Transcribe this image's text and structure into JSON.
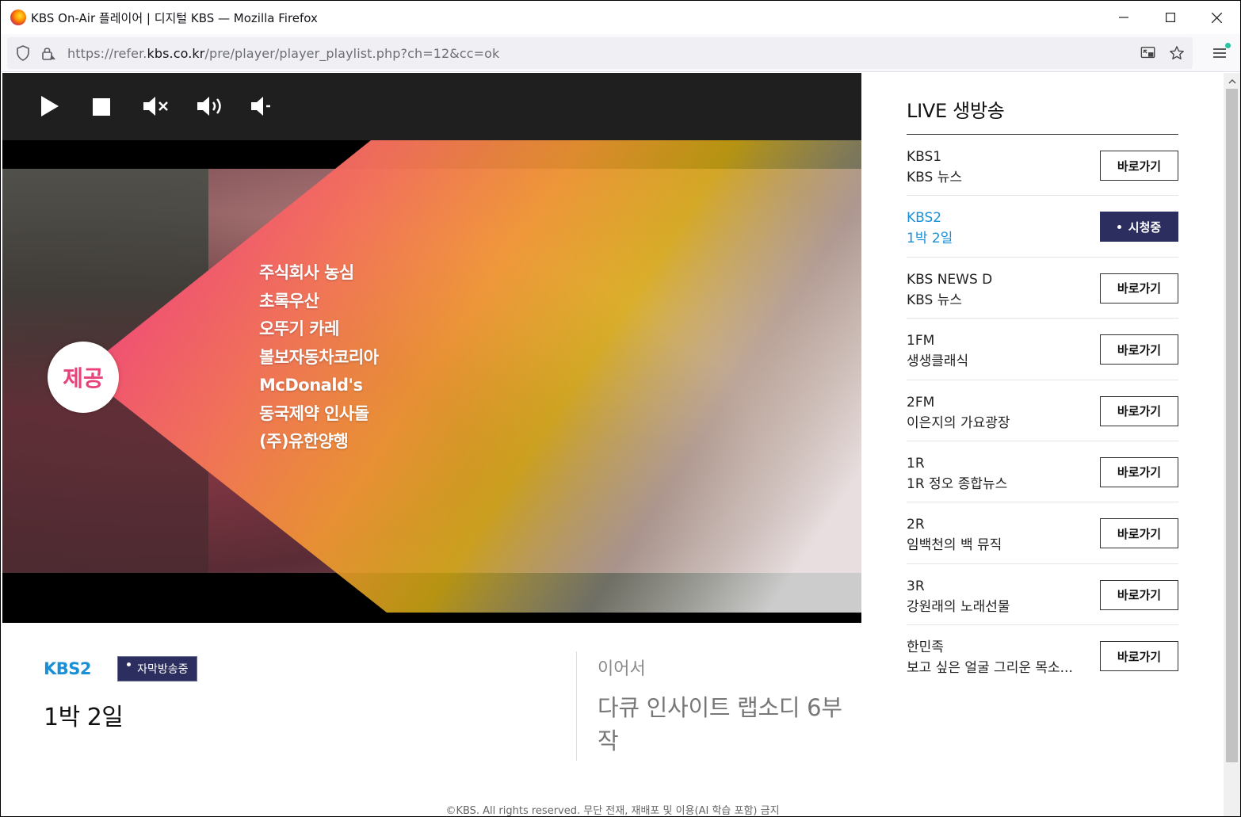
{
  "window": {
    "title": "KBS On-Air 플레이어 | 디지털 KBS — Mozilla Firefox",
    "minimize": "—",
    "maximize": "☐",
    "close": "✕"
  },
  "navbar": {
    "url_prefix": "https://refer.",
    "url_domain": "kbs.co.kr",
    "url_path": "/pre/player/player_playlist.php?ch=12&cc=ok"
  },
  "player": {
    "controls": [
      "play-icon",
      "stop-icon",
      "mute-icon",
      "volume-up-icon",
      "volume-down-icon"
    ],
    "sponsor_badge": "제공",
    "sponsors": [
      "주식회사 농심",
      "초록우산",
      "오뚜기 카레",
      "볼보자동차코리아",
      "McDonald's",
      "동국제약 인사돌",
      "(주)유한양행"
    ]
  },
  "now_playing": {
    "channel": "KBS2",
    "caption_badge": "자막방송중",
    "title": "1박 2일",
    "next_label": "이어서",
    "next_title": "다큐 인사이트 랩소디 6부작"
  },
  "sidebar": {
    "title": "LIVE 생방송",
    "channels": [
      {
        "name": "KBS1",
        "program": "KBS 뉴스",
        "button": "바로가기",
        "active": false
      },
      {
        "name": "KBS2",
        "program": "1박 2일",
        "button": "시청중",
        "active": true
      },
      {
        "name": "KBS NEWS D",
        "program": "KBS 뉴스",
        "button": "바로가기",
        "active": false
      },
      {
        "name": "1FM",
        "program": "생생클래식",
        "button": "바로가기",
        "active": false
      },
      {
        "name": "2FM",
        "program": "이은지의 가요광장",
        "button": "바로가기",
        "active": false
      },
      {
        "name": "1R",
        "program": "1R 정오 종합뉴스",
        "button": "바로가기",
        "active": false
      },
      {
        "name": "2R",
        "program": "임백천의 백 뮤직",
        "button": "바로가기",
        "active": false
      },
      {
        "name": "3R",
        "program": "강원래의 노래선물",
        "button": "바로가기",
        "active": false
      },
      {
        "name": "한민족",
        "program": "보고 싶은 얼굴 그리운 목소...",
        "button": "바로가기",
        "active": false
      }
    ]
  },
  "footer": {
    "text": "©KBS. All rights reserved. 무단 전재, 재배포 및 이용(AI 학습 포함) 금지"
  },
  "colors": {
    "accent_blue": "#1a8fd6",
    "badge_navy": "#2b2e5e"
  }
}
